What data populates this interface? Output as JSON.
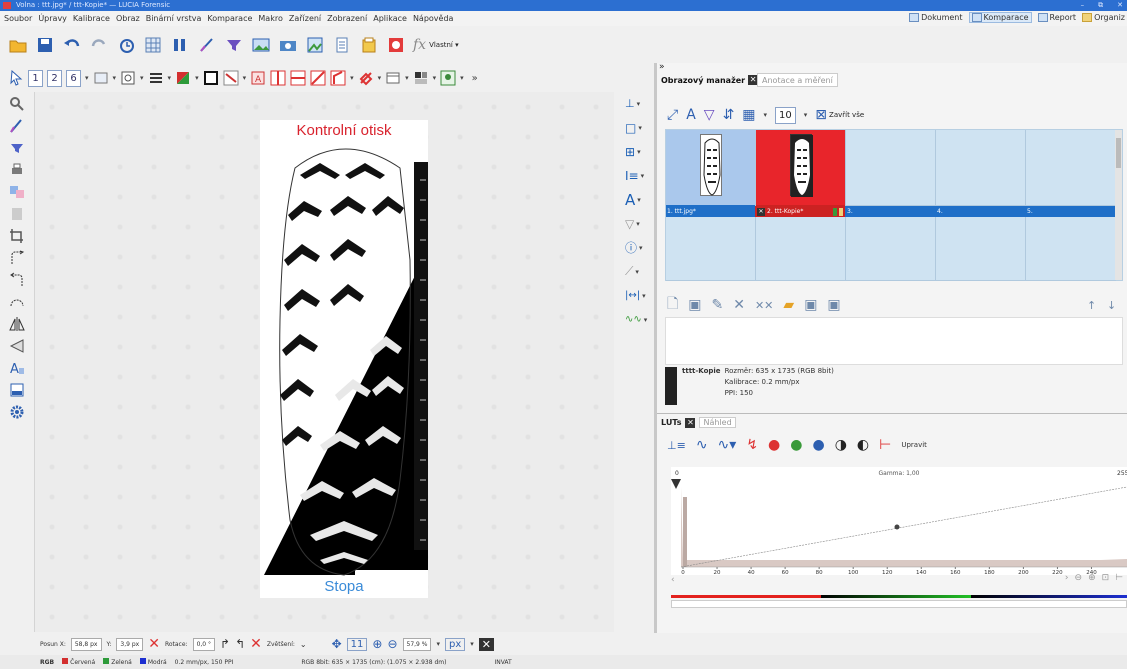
{
  "window": {
    "title": "Volna : ttt.jpg* / ttt-Kopie* — LUCIA Forensic",
    "controls": [
      "–",
      "⧉",
      "✕"
    ]
  },
  "menu": {
    "items": [
      "Soubor",
      "Úpravy",
      "Kalibrace",
      "Obraz",
      "Binární vrstva",
      "Komparace",
      "Makro",
      "Zařízení",
      "Zobrazení",
      "Aplikace",
      "Nápověda"
    ],
    "right": [
      "Dokument",
      "Komparace",
      "Report",
      "Organiz"
    ]
  },
  "toolbar": {
    "fx_label": "Vlastní ▾",
    "number_buttons": [
      "1",
      "2",
      "6"
    ]
  },
  "canvas": {
    "top_label": "Kontrolní otisk",
    "bottom_label": "Stopa"
  },
  "image_manager": {
    "tab_active": "Obrazový manažer",
    "tab_inactive": "Anotace a měření",
    "count": "10",
    "close_all": "Zavřít vše",
    "cells": [
      {
        "label": "1. ttt.jpg*"
      },
      {
        "label": "2. ttt-Kopie*"
      },
      {
        "label": "3."
      },
      {
        "label": "4."
      },
      {
        "label": "5."
      }
    ],
    "info": {
      "name": "tttt-Kopie",
      "size": "Rozměr: 635 x 1735 (RGB 8bit)",
      "calibration": "Kalibrace: 0.2 mm/px",
      "ppi": "PPI: 150"
    }
  },
  "luts": {
    "tab_active": "LUTs",
    "tab_inactive": "Náhled",
    "edit": "Upravit",
    "gamma": "Gamma: 1,00",
    "axis_min": "0",
    "axis_max": "255",
    "ticks": [
      "0",
      "20",
      "40",
      "60",
      "80",
      "100",
      "120",
      "140",
      "160",
      "180",
      "200",
      "220",
      "240"
    ]
  },
  "statusbar": {
    "posx_label": "Posun X:",
    "posx": "58,8 px",
    "posy_label": "Y:",
    "posy": "3,9 px",
    "rot_label": "Rotace:",
    "rot": "0,0 °",
    "zoom_label": "Zvětšení:",
    "zoom_num": "11",
    "zoom_pct": "57,9 %",
    "unit": "px",
    "channel": "RGB",
    "ch_red": "Červená",
    "ch_green": "Zelená",
    "ch_blue": "Modrá",
    "calib": "0.2 mm/px, 150 PPI",
    "info": "RGB 8bit: 635 × 1735 (cm): (1.075 × 2.938 dm)",
    "mode": "INVAT"
  }
}
